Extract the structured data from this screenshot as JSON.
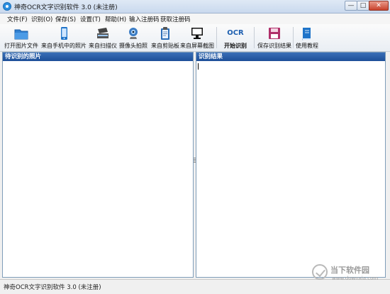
{
  "window": {
    "title": "神奇OCR文字识别软件 3.0 (未注册)",
    "minimize": "—",
    "maximize": "□",
    "close": "✕"
  },
  "menu": [
    {
      "label": "文件(F)"
    },
    {
      "label": "识别(O)"
    },
    {
      "label": "保存(S)"
    },
    {
      "label": "设置(T)"
    },
    {
      "label": "帮助(H)"
    },
    {
      "label": "输入注册码"
    },
    {
      "label": "获取注册码"
    }
  ],
  "toolbar": {
    "open_file": "打开图片文件",
    "from_phone": "来自手机中的照片",
    "from_scanner": "来自扫描仪",
    "webcam": "摄像头拍照",
    "clipboard": "来自剪贴板",
    "screenshot": "来自屏幕截图",
    "ocr_badge": "OCR",
    "start_ocr": "开始识别",
    "save_result": "保存识别结果",
    "tutorial": "使用教程"
  },
  "panels": {
    "left_title": "待识别的照片",
    "right_title": "识别结果"
  },
  "status": {
    "text": "神奇OCR文字识别软件 3.0 (未注册)"
  },
  "watermark": {
    "name": "当下软件园",
    "url": "www.downxia.com"
  }
}
